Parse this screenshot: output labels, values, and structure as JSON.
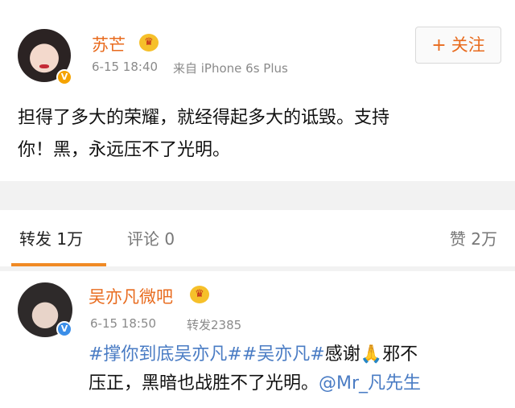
{
  "post": {
    "author": "苏芒",
    "crown_icon": "crown-icon",
    "timestamp": "6-15 18:40",
    "source": "来自 iPhone 6s Plus",
    "follow_plus": "+",
    "follow_label": "关注",
    "content_line1": "担得了多大的荣耀，就经得起多大的诋毁。支持",
    "content_line2": "你！黑，永远压不了光明。",
    "verified_badge": "V"
  },
  "tabs": {
    "forward": "转发 1万",
    "comment": "评论 0",
    "like": "赞 2万"
  },
  "repost": {
    "author": "吴亦凡微吧",
    "timestamp": "6-15 18:50",
    "repost_count": "转发2385",
    "verified_badge": "V",
    "hashtag1": "#撑你到底吴亦凡#",
    "hashtag2": "#吴亦凡#",
    "thanks": "感谢",
    "pray_icon": "🙏",
    "text_after_pray": "邪不",
    "line2_text": "压正，黑暗也战胜不了光明。",
    "mention": "@Mr_凡先生"
  },
  "colors": {
    "accent_orange": "#e86b1e",
    "link_blue": "#4a7cc4",
    "tab_underline": "#f08a24"
  }
}
